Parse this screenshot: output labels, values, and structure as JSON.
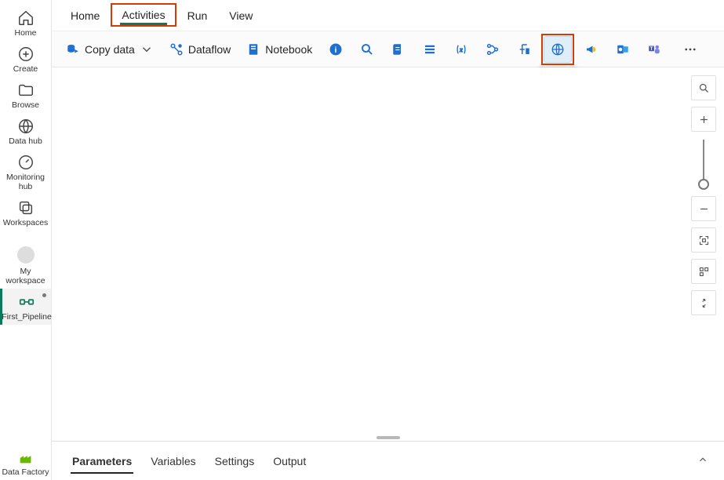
{
  "rail": {
    "home": "Home",
    "create": "Create",
    "browse": "Browse",
    "datahub": "Data hub",
    "monitoring": "Monitoring hub",
    "workspaces": "Workspaces",
    "my_workspace": "My workspace",
    "pipeline": "First_Pipeline",
    "product": "Data Factory"
  },
  "tabs": {
    "home": "Home",
    "activities": "Activities",
    "run": "Run",
    "view": "View"
  },
  "toolbar": {
    "copy_data": "Copy data",
    "dataflow": "Dataflow",
    "notebook": "Notebook",
    "web_tooltip": "Web"
  },
  "bottom": {
    "parameters": "Parameters",
    "variables": "Variables",
    "settings": "Settings",
    "output": "Output"
  }
}
